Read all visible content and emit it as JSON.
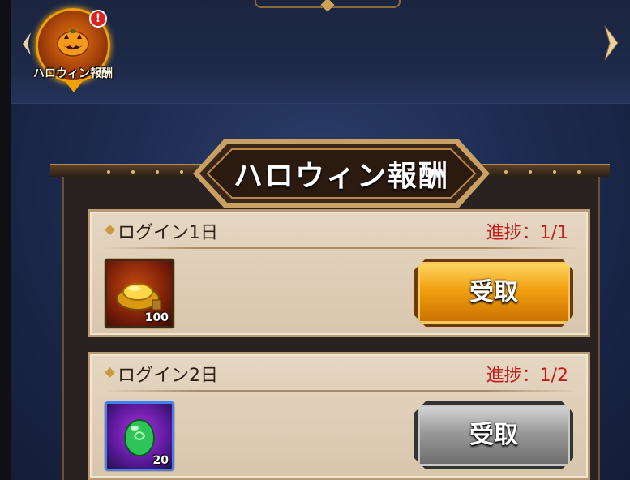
{
  "event": {
    "icon_label": "ハロウィン報酬",
    "alert": "!"
  },
  "panel": {
    "title": "ハロウィン報酬"
  },
  "rewards": [
    {
      "title": "ログイン1日",
      "progress": "進捗：1/1",
      "item": {
        "icon": "gold-ingot-icon",
        "count": "100"
      },
      "button": {
        "label": "受取",
        "state": "active"
      }
    },
    {
      "title": "ログイン2日",
      "progress": "進捗：1/2",
      "item": {
        "icon": "green-gem-icon",
        "count": "20"
      },
      "button": {
        "label": "受取",
        "state": "disabled"
      }
    }
  ],
  "colors": {
    "progress_text": "#c41a1a",
    "active_button": "#f2a010",
    "disabled_button": "#9a9a9a",
    "background": "#1e2c52"
  }
}
